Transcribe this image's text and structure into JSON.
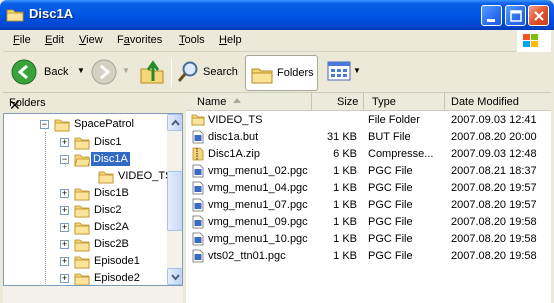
{
  "window": {
    "title": "Disc1A"
  },
  "menu": [
    {
      "label": "File",
      "u": "F"
    },
    {
      "label": "Edit",
      "u": "E"
    },
    {
      "label": "View",
      "u": "V"
    },
    {
      "label": "Favorites",
      "u": "a"
    },
    {
      "label": "Tools",
      "u": "T"
    },
    {
      "label": "Help",
      "u": "H"
    }
  ],
  "toolbar": {
    "back_label": "Back",
    "search_label": "Search",
    "folders_label": "Folders"
  },
  "left_pane": {
    "header": "Folders"
  },
  "tree": [
    {
      "label": "SpacePatrol",
      "level": 0,
      "expander": "−",
      "selected": false
    },
    {
      "label": "Disc1",
      "level": 1,
      "expander": "+",
      "selected": false
    },
    {
      "label": "Disc1A",
      "level": 1,
      "expander": "−",
      "selected": true
    },
    {
      "label": "VIDEO_TS",
      "level": 2,
      "expander": "",
      "selected": false
    },
    {
      "label": "Disc1B",
      "level": 1,
      "expander": "+",
      "selected": false
    },
    {
      "label": "Disc2",
      "level": 1,
      "expander": "+",
      "selected": false
    },
    {
      "label": "Disc2A",
      "level": 1,
      "expander": "+",
      "selected": false
    },
    {
      "label": "Disc2B",
      "level": 1,
      "expander": "+",
      "selected": false
    },
    {
      "label": "Episode1",
      "level": 1,
      "expander": "+",
      "selected": false
    },
    {
      "label": "Episode2",
      "level": 1,
      "expander": "+",
      "selected": false
    }
  ],
  "columns": {
    "name": "Name",
    "size": "Size",
    "type": "Type",
    "modified": "Date Modified"
  },
  "files": [
    {
      "name": "VIDEO_TS",
      "size": "",
      "type": "File Folder",
      "modified": "2007.09.03 12:41",
      "icon": "folder-icon"
    },
    {
      "name": "disc1a.but",
      "size": "31 KB",
      "type": "BUT File",
      "modified": "2007.08.20 20:00",
      "icon": "file-icon"
    },
    {
      "name": "Disc1A.zip",
      "size": "6 KB",
      "type": "Compresse...",
      "modified": "2007.09.03 12:48",
      "icon": "zip-icon"
    },
    {
      "name": "vmg_menu1_02.pgc",
      "size": "1 KB",
      "type": "PGC File",
      "modified": "2007.08.21 18:37",
      "icon": "pgc-icon"
    },
    {
      "name": "vmg_menu1_04.pgc",
      "size": "1 KB",
      "type": "PGC File",
      "modified": "2007.08.20 19:57",
      "icon": "pgc-icon"
    },
    {
      "name": "vmg_menu1_07.pgc",
      "size": "1 KB",
      "type": "PGC File",
      "modified": "2007.08.20 19:57",
      "icon": "pgc-icon"
    },
    {
      "name": "vmg_menu1_09.pgc",
      "size": "1 KB",
      "type": "PGC File",
      "modified": "2007.08.20 19:58",
      "icon": "pgc-icon"
    },
    {
      "name": "vmg_menu1_10.pgc",
      "size": "1 KB",
      "type": "PGC File",
      "modified": "2007.08.20 19:58",
      "icon": "pgc-icon"
    },
    {
      "name": "vts02_ttn01.pgc",
      "size": "1 KB",
      "type": "PGC File",
      "modified": "2007.08.20 19:58",
      "icon": "pgc-icon"
    }
  ]
}
